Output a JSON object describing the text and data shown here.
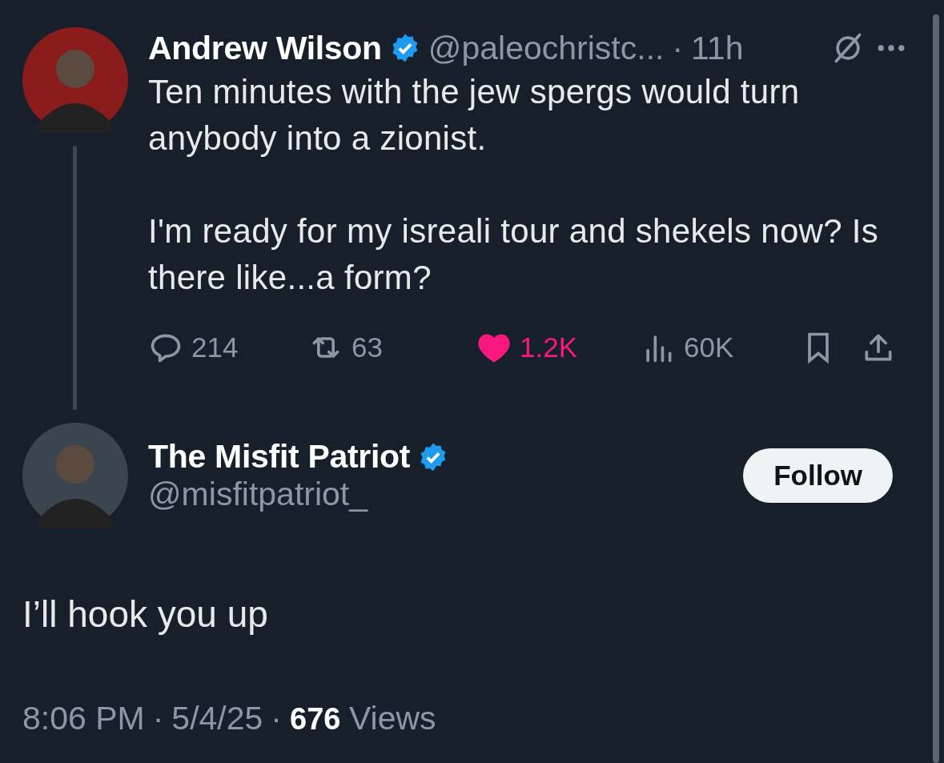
{
  "tweet": {
    "name": "Andrew Wilson",
    "verified": true,
    "handle": "@paleochristc...",
    "separator": "·",
    "time": "11h",
    "paragraphs": [
      "Ten minutes with the jew spergs would turn anybody into a zionist.",
      "I'm ready for my isreali tour and shekels now? Is there like...a form?"
    ],
    "actions": [
      {
        "kind": "reply",
        "count": "214"
      },
      {
        "kind": "repost",
        "count": "63"
      },
      {
        "kind": "like",
        "count": "1.2K",
        "selected": true
      },
      {
        "kind": "views",
        "count": "60K"
      },
      {
        "kind": "bookmark",
        "selected": false
      },
      {
        "kind": "share"
      }
    ]
  },
  "reply": {
    "name": "The Misfit Patriot",
    "verified": true,
    "handle": "@misfitpatriot_",
    "follow": "Follow",
    "text": "I’ll hook you up",
    "time": "8:06 PM",
    "separators": [
      "·",
      "·"
    ],
    "date": "5/4/25",
    "views_count": "676",
    "views_label": "Views"
  }
}
